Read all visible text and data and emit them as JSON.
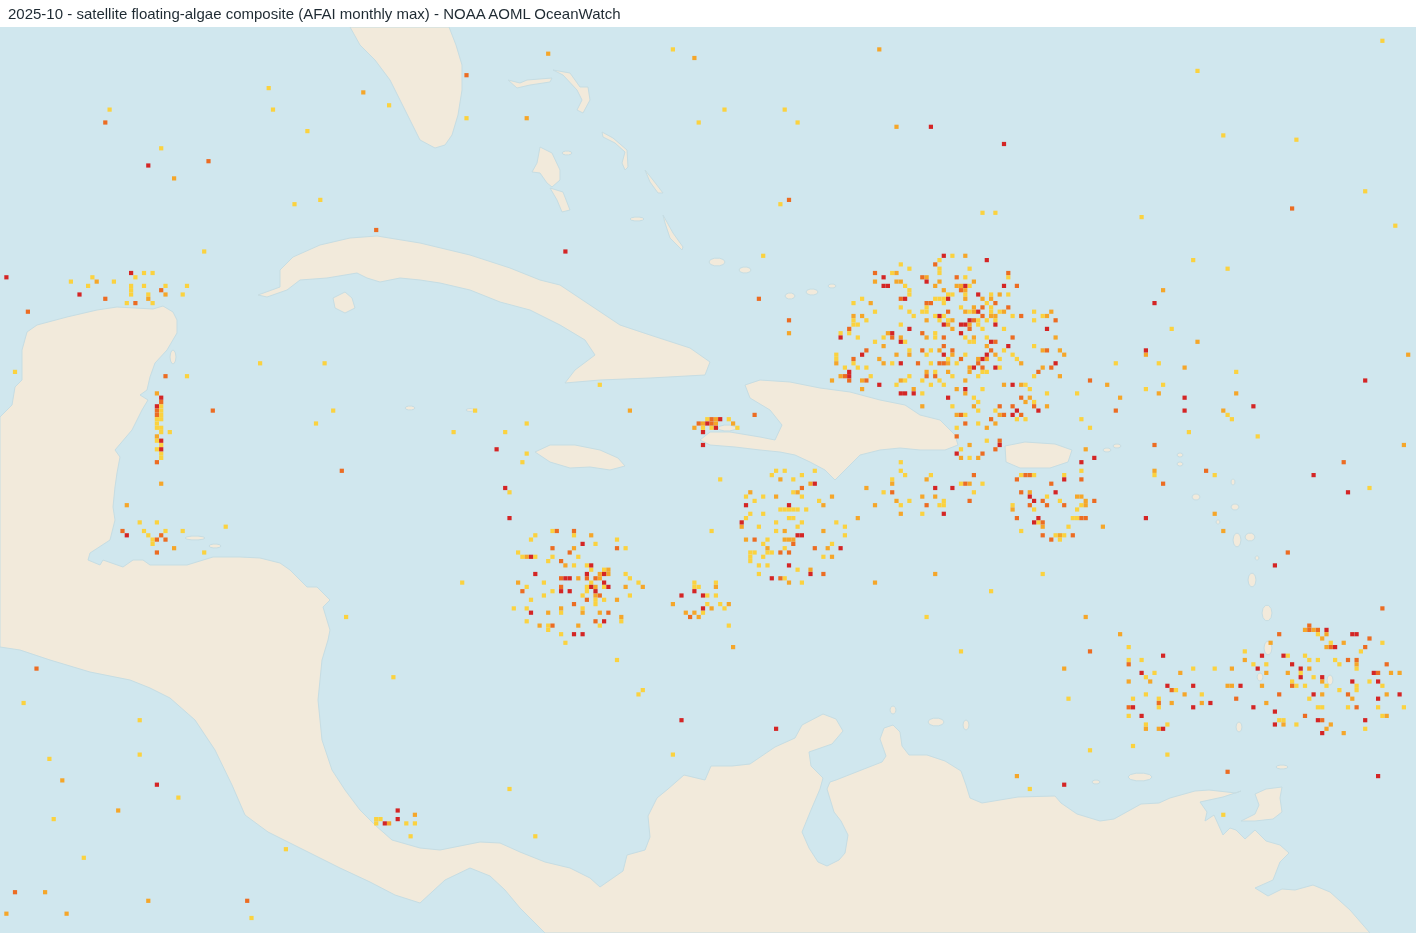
{
  "title": "2025-10 - satellite floating-algae composite (AFAI monthly max) - NOAA AOML OceanWatch"
}
